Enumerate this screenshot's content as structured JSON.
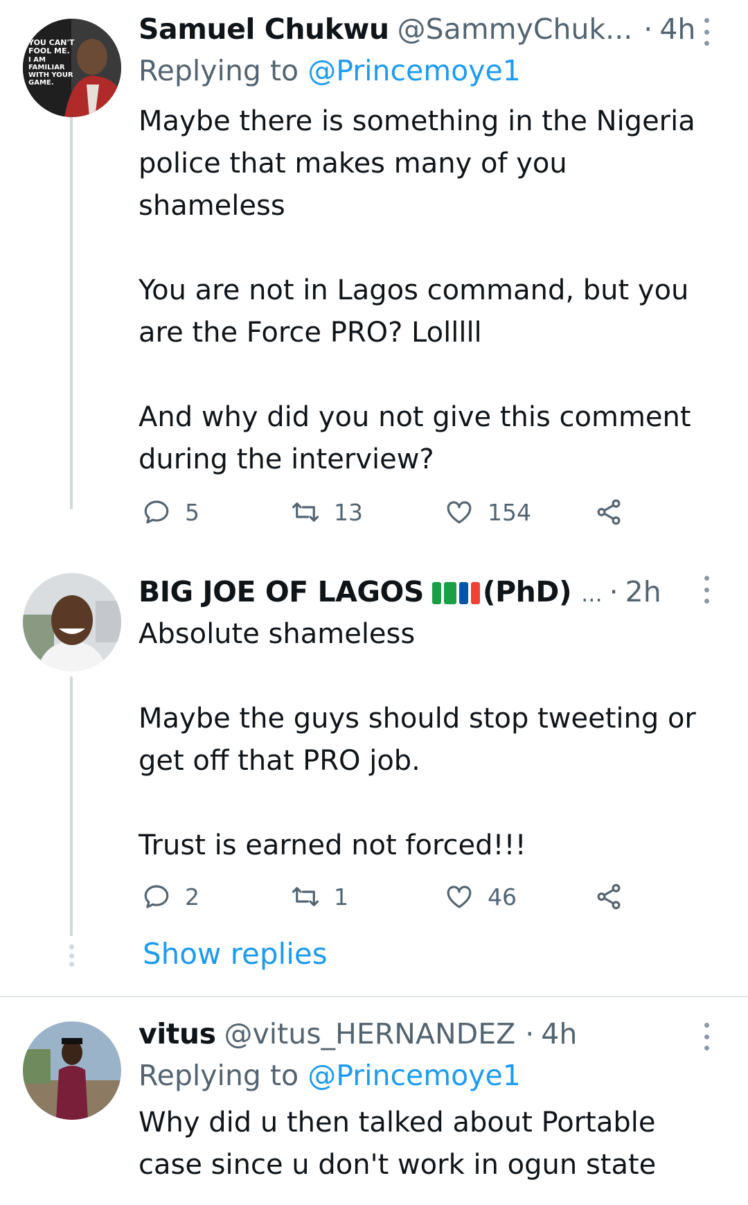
{
  "replies": [
    {
      "name": "Samuel Chukwu",
      "handle": "@SammyChuk...",
      "time": "4h",
      "dot": "·",
      "replying_prefix": "Replying to",
      "replying_to": "@Princemoye1",
      "avatar_text": "YOU CAN'T FOOL ME. I AM FAMILIAR WITH YOUR GAME.",
      "body": [
        "Maybe there is something in the Nigeria police that makes many of you shameless",
        "",
        "You are not in Lagos command, but you are the Force PRO? Lolllll",
        "",
        "And why did you not give this comment during the interview?"
      ],
      "reply_count": "5",
      "retweet_count": "13",
      "like_count": "154"
    },
    {
      "name": "BIG JOE OF LAGOS",
      "name_suffix": "(PhD)",
      "ellipsis": "...",
      "time": "2h",
      "dot": "·",
      "body": [
        "Absolute shameless",
        "",
        "Maybe the guys should stop tweeting or get off that PRO job.",
        "",
        "Trust is earned not forced!!!"
      ],
      "reply_count": "2",
      "retweet_count": "1",
      "like_count": "46",
      "flag_colors": [
        "#1a9e46",
        "#ffffff",
        "#1a9e46",
        "#0055a4",
        "#ffffff",
        "#ef4135"
      ]
    },
    {
      "name": "vitus",
      "handle": "@vitus_HERNANDEZ",
      "time": "4h",
      "dot": "·",
      "replying_prefix": "Replying to",
      "replying_to": "@Princemoye1",
      "body": [
        "Why did u then talked about Portable case since u don't work in ogun state"
      ]
    }
  ],
  "show_replies": "Show replies",
  "colors": {
    "link": "#1d9bf0",
    "secondary": "#536471",
    "text": "#0f1419",
    "thread_line": "#cfd9de"
  },
  "icons": {
    "reply": "reply-icon",
    "retweet": "retweet-icon",
    "like": "like-icon",
    "share": "share-icon",
    "more": "more-icon"
  }
}
